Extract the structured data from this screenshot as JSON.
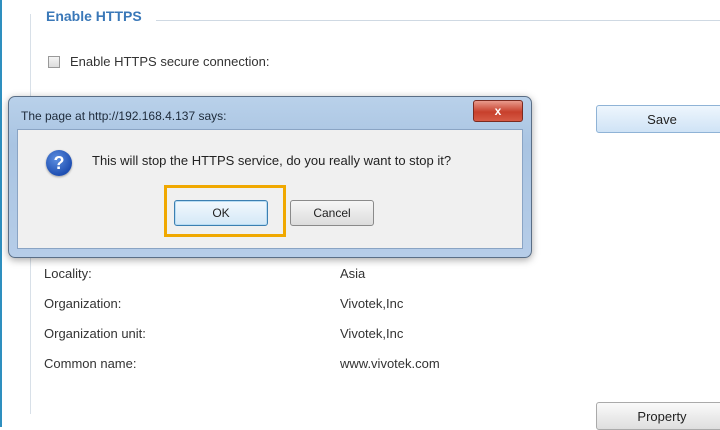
{
  "section": {
    "title": "Enable HTTPS"
  },
  "https_checkbox": {
    "label": "Enable HTTPS secure connection:",
    "checked": false
  },
  "save_button": {
    "label": "Save"
  },
  "certificate_info": [
    {
      "label": "Locality:",
      "value": "Asia"
    },
    {
      "label": "Organization:",
      "value": "Vivotek,Inc"
    },
    {
      "label": "Organization unit:",
      "value": "Vivotek,Inc"
    },
    {
      "label": "Common name:",
      "value": "www.vivotek.com"
    }
  ],
  "property_button": {
    "label": "Property"
  },
  "dialog": {
    "title": "The page at http://192.168.4.137 says:",
    "close_label": "x",
    "icon": "question-icon",
    "message": "This will stop the HTTPS service, do you really want to stop it?",
    "ok_label": "OK",
    "cancel_label": "Cancel",
    "highlight_color": "#f0a800"
  }
}
